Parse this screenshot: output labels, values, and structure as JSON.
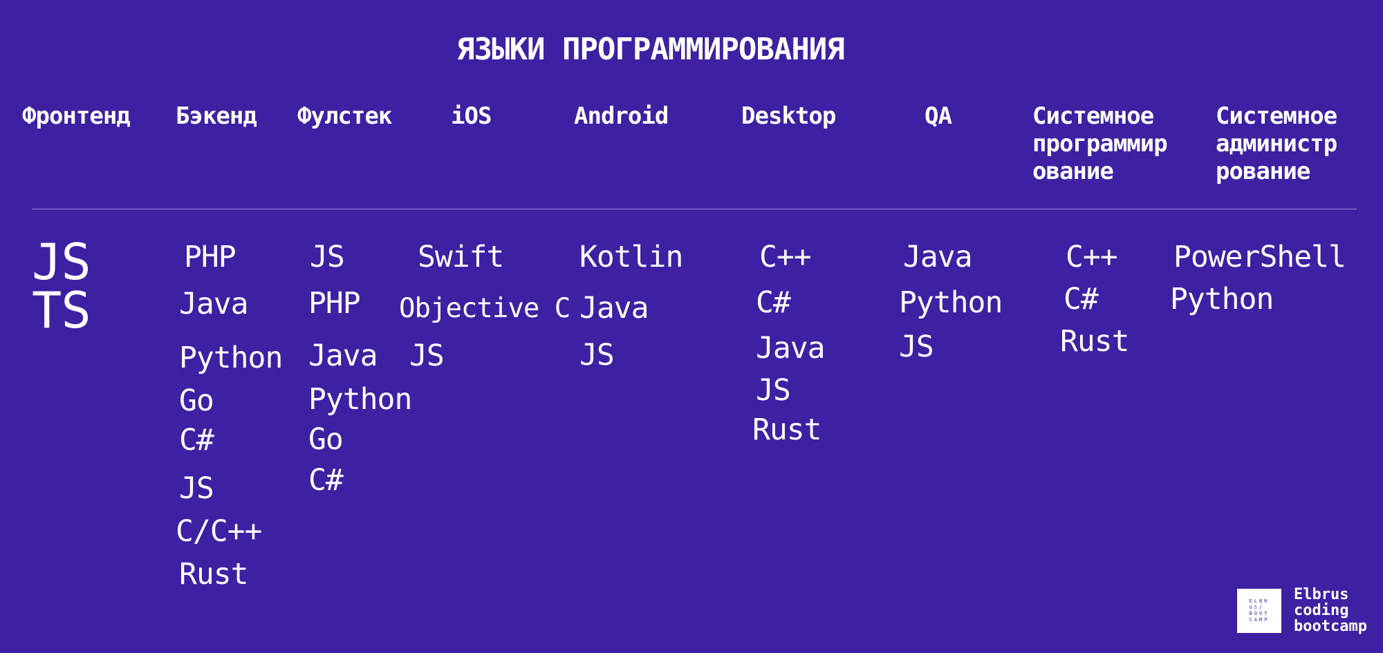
{
  "title": "ЯЗЫКИ ПРОГРАММИРОВАНИЯ",
  "columns": [
    {
      "heading": "Фронтенд",
      "langs": [
        "JS",
        "TS"
      ]
    },
    {
      "heading": "Бэкенд",
      "langs": [
        "PHP",
        "Java",
        "Python",
        "Go",
        "C#",
        "JS",
        "C/C++",
        "Rust"
      ]
    },
    {
      "heading": "Фулстек",
      "langs": [
        "JS",
        "PHP",
        "Java",
        "Python",
        "Go",
        "C#"
      ]
    },
    {
      "heading": "iOS",
      "langs": [
        "Swift",
        "Objective C",
        "JS"
      ]
    },
    {
      "heading": "Android",
      "langs": [
        "Kotlin",
        "Java",
        "JS"
      ]
    },
    {
      "heading": "Desktop",
      "langs": [
        "C++",
        "C#",
        "Java",
        "JS",
        "Rust"
      ]
    },
    {
      "heading": "QA",
      "langs": [
        "Java",
        "Python",
        "JS"
      ]
    },
    {
      "heading": "Системное\nпрограммир\nование",
      "langs": [
        "C++",
        "C#",
        "Rust"
      ]
    },
    {
      "heading": "Системное\nадминистр\nрование",
      "langs": [
        "PowerShell",
        "Python"
      ]
    }
  ],
  "logo": {
    "mark": "ELBRUS/BOOTCAMP",
    "text": "Elbrus\ncoding\nbootcamp"
  }
}
